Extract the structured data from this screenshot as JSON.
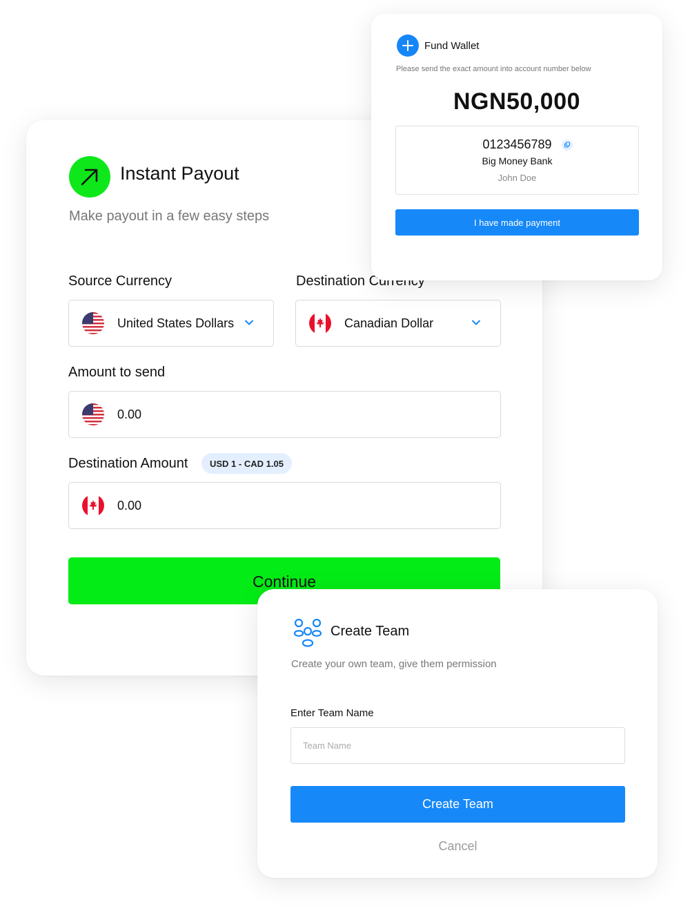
{
  "payout": {
    "title": "Instant Payout",
    "subtitle": "Make payout in a few easy steps",
    "source_label": "Source Currency",
    "source_value": "United States Dollars",
    "destination_label": "Destination Currency",
    "destination_value": "Canadian Dollar",
    "amount_label": "Amount to send",
    "amount_value": "0.00",
    "dest_amount_label": "Destination Amount",
    "rate_badge": "USD 1 - CAD 1.05",
    "dest_amount_value": "0.00",
    "continue_label": "Continue",
    "icons": [
      "arrow-up-right-icon",
      "us-flag-icon",
      "canada-flag-icon",
      "chevron-down-icon"
    ]
  },
  "fund_wallet": {
    "title": "Fund Wallet",
    "instruction": "Please send the exact amount into account number below",
    "amount": "NGN50,000",
    "account_number": "0123456789",
    "bank_name": "Big Money Bank",
    "account_name": "John Doe",
    "paid_button": "I have made payment",
    "icons": [
      "plus-icon",
      "copy-icon"
    ]
  },
  "create_team": {
    "title": "Create Team",
    "subtitle": "Create your own team, give them permission",
    "name_label": "Enter Team Name",
    "name_placeholder": "Team Name",
    "name_value": "",
    "submit_label": "Create Team",
    "cancel_label": "Cancel",
    "icons": [
      "team-icon"
    ]
  },
  "colors": {
    "green": "#03ec16",
    "blue": "#1688f8",
    "badge_bg": "#e3efff",
    "canada_red": "#e8112d"
  }
}
